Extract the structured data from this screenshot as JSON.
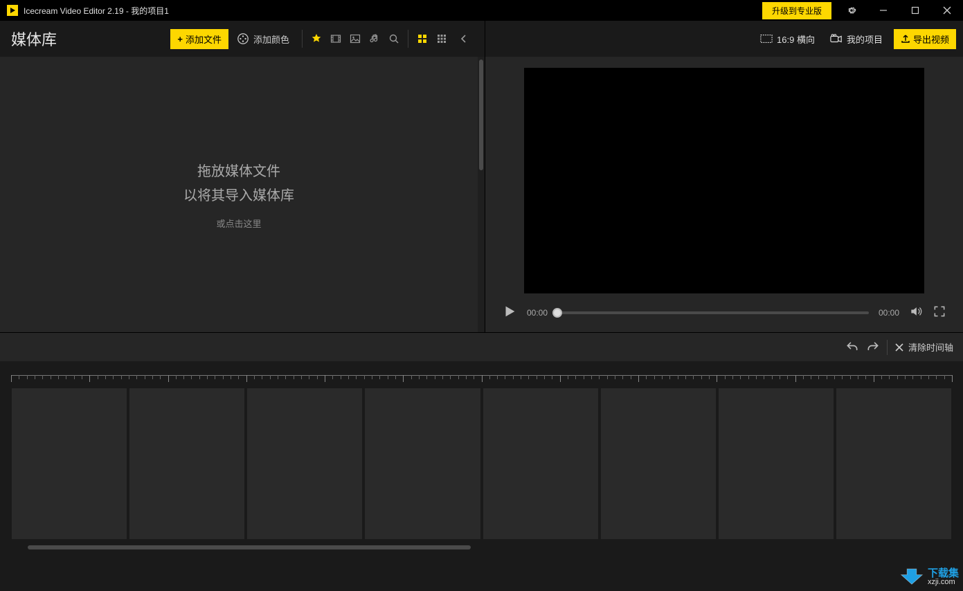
{
  "titlebar": {
    "app_title": "Icecream Video Editor 2.19  - 我的项目1",
    "upgrade_label": "升级到专业版"
  },
  "media": {
    "heading": "媒体库",
    "add_file_label": "添加文件",
    "add_color_label": "添加颜色",
    "drop_line1": "拖放媒体文件",
    "drop_line2": "以将其导入媒体库",
    "drop_line3": "或点击这里"
  },
  "preview": {
    "aspect_label": "16:9 横向",
    "project_label": "我的项目",
    "export_label": "导出视频",
    "time_current": "00:00",
    "time_total": "00:00"
  },
  "timeline": {
    "clear_label": "清除时间轴",
    "slot_count": 8
  },
  "watermark": {
    "name": "下载集",
    "url": "xzji.com"
  }
}
